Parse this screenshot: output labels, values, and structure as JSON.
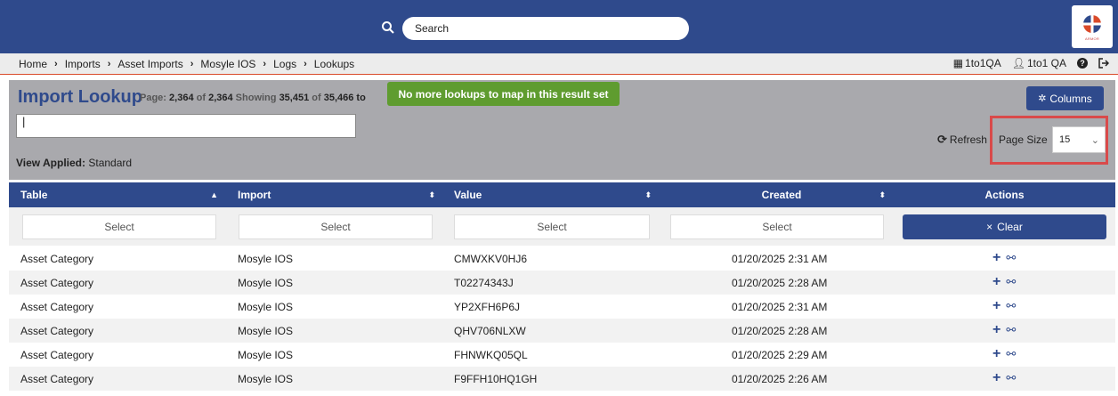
{
  "topbar": {
    "search_placeholder": "Search",
    "logo_text": "ARMOR"
  },
  "breadcrumb": [
    "Home",
    "Imports",
    "Asset Imports",
    "Mosyle IOS",
    "Logs",
    "Lookups"
  ],
  "userbar": {
    "org": "1to1QA",
    "user": "1to1 QA"
  },
  "panel": {
    "title": "Import Lookup",
    "page_label": "Page:",
    "page_current": "2,364",
    "page_of": "of",
    "page_total": "2,364",
    "showing_label": "Showing",
    "showing_count": "35,451",
    "showing_of": "of",
    "showing_total": "35,466 to",
    "toast": "No more lookups to map in this result set",
    "filter_value": "|",
    "view_label": "View Applied:",
    "view_value": "Standard",
    "columns_label": "Columns",
    "refresh_label": "Refresh",
    "page_size_label": "Page Size",
    "page_size_value": "15"
  },
  "table": {
    "columns": [
      "Table",
      "Import",
      "Value",
      "Created",
      "Actions"
    ],
    "filter_placeholder": "Select",
    "clear_label": "Clear",
    "rows": [
      {
        "table": "Asset Category",
        "import": "Mosyle IOS",
        "value": "CMWXKV0HJ6",
        "created": "01/20/2025 2:31 AM"
      },
      {
        "table": "Asset Category",
        "import": "Mosyle IOS",
        "value": "T02274343J",
        "created": "01/20/2025 2:28 AM"
      },
      {
        "table": "Asset Category",
        "import": "Mosyle IOS",
        "value": "YP2XFH6P6J",
        "created": "01/20/2025 2:31 AM"
      },
      {
        "table": "Asset Category",
        "import": "Mosyle IOS",
        "value": "QHV706NLXW",
        "created": "01/20/2025 2:28 AM"
      },
      {
        "table": "Asset Category",
        "import": "Mosyle IOS",
        "value": "FHNWKQ05QL",
        "created": "01/20/2025 2:29 AM"
      },
      {
        "table": "Asset Category",
        "import": "Mosyle IOS",
        "value": "F9FFH10HQ1GH",
        "created": "01/20/2025 2:26 AM"
      }
    ]
  },
  "colors": {
    "brand": "#2f4a8c",
    "toast": "#5f9c2f",
    "highlight": "#d94a4a"
  }
}
